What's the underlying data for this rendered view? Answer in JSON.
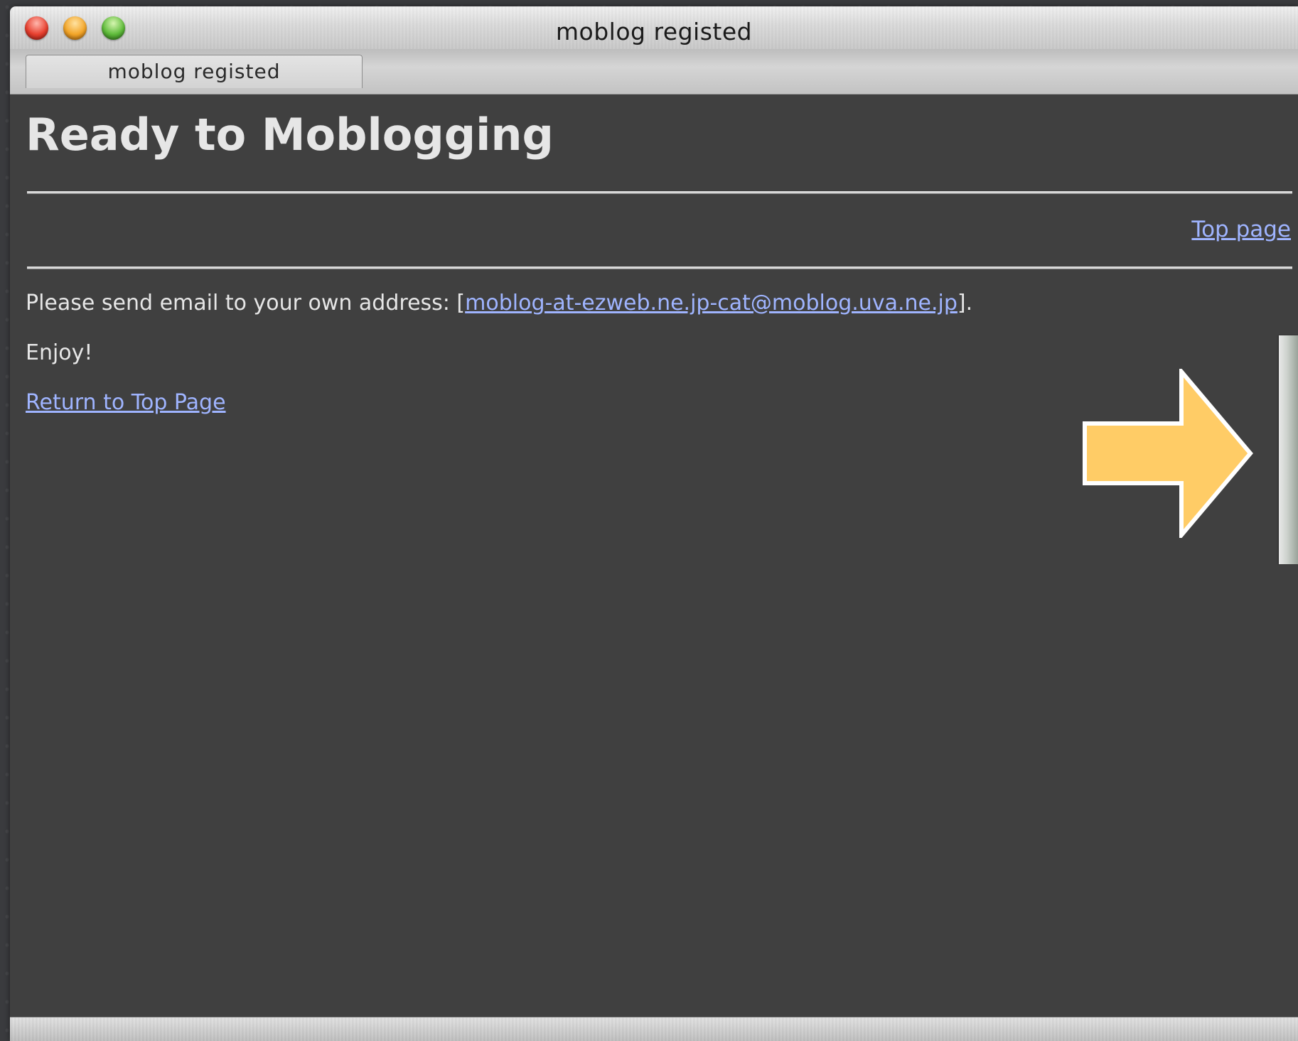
{
  "window": {
    "title": "moblog registed"
  },
  "tabs": [
    {
      "label": "moblog registed"
    }
  ],
  "page": {
    "heading": "Ready to Moblogging",
    "top_link": "Top page",
    "instruction_prefix": "Please send email to your own address: [",
    "email": "moblog-at-ezweb.ne.jp-cat@moblog.uva.ne.jp",
    "instruction_suffix": "].",
    "enjoy": "Enjoy!",
    "return_link": "Return to Top Page"
  },
  "colors": {
    "background": "#404040",
    "text": "#e6e6e6",
    "link": "#9fb4ff",
    "arrow": "#ffcc66"
  },
  "icons": {
    "annotation": "right-arrow-icon"
  }
}
